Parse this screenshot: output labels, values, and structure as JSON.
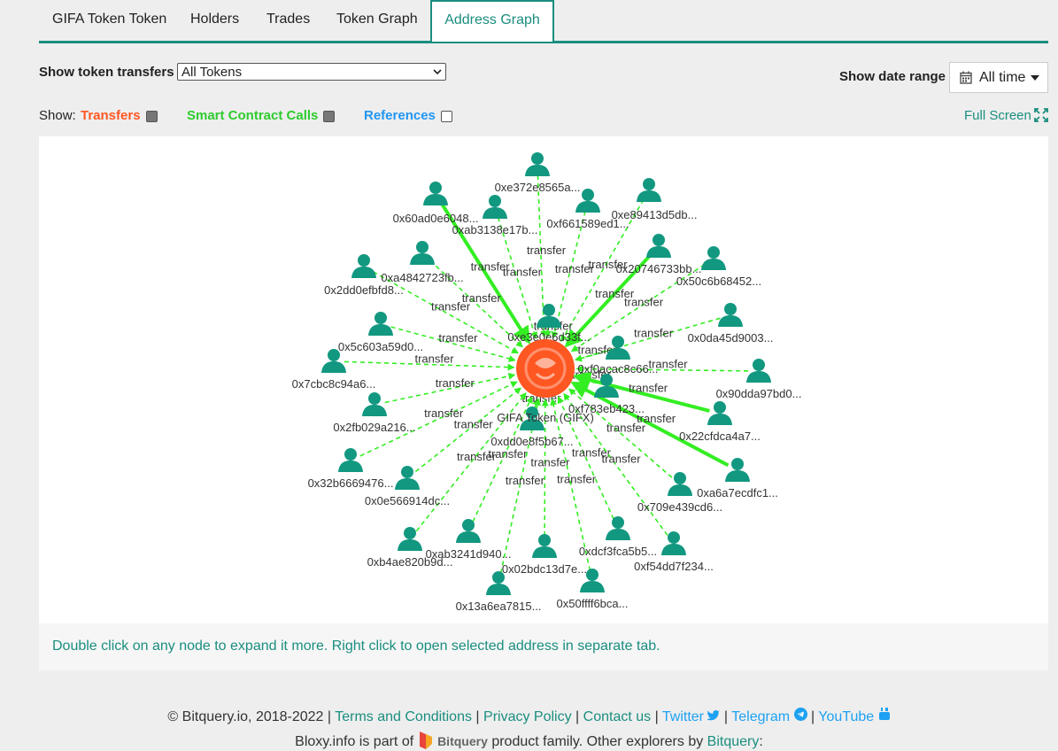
{
  "tabs": [
    "GIFA Token Token",
    "Holders",
    "Trades",
    "Token Graph",
    "Address Graph"
  ],
  "filters": {
    "token_label": "Show token transfers",
    "token_value": "All Tokens",
    "date_label": "Show date range",
    "date_value": "All time"
  },
  "show": {
    "label": "Show:",
    "transfers": "Transfers",
    "smart_contract_calls": "Smart Contract Calls",
    "references": "References",
    "full_screen": "Full Screen"
  },
  "colors": {
    "accent": "#1a8e7f",
    "transfers": "#ff5722",
    "smart_contract_calls": "#2ecc2e",
    "references": "#2196f3",
    "edge": "#33ee22",
    "node": "#129880"
  },
  "graph": {
    "center_label": "GIFA Token (GIFX)",
    "edge_label": "transfer",
    "nodes": [
      "0xe372e8565a...",
      "0x60ad0e6048...",
      "0xab3138e17b...",
      "0xf661589ed1...",
      "0xe89413d5db...",
      "0xa4842723fb...",
      "0x2dd0efbfd8...",
      "0x20746733bb...",
      "0x50c6b68452...",
      "0xe3e0e6d33f...",
      "0x0da45d9003...",
      "0x5c603a59d0...",
      "0x7cbc8c94a6...",
      "0xf0acac8c66...",
      "0x90dda97bd0...",
      "0x2fb029a216...",
      "0xf783eb423...",
      "0x22cfdca4a7...",
      "0xdd0e8f5b67...",
      "0x32b6669476...",
      "0x0e566914dc...",
      "0xa6a7ecdfc1...",
      "0x709e439cd6...",
      "0xb4ae820b9d...",
      "0xab3241d940...",
      "0xdcf3fca5b5...",
      "0xf54dd7f234...",
      "0x02bdc13d7e...",
      "0x13a6ea7815...",
      "0x50ffff6bca..."
    ]
  },
  "hint": "Double click on any node to expand it more. Right click to open selected address in separate tab.",
  "footer": {
    "copyright": "© Bitquery.io, 2018-2022",
    "links": [
      "Terms and Conditions",
      "Privacy Policy",
      "Contact us",
      "Twitter",
      "Telegram",
      "YouTube"
    ],
    "line2_a": "Bloxy.info is part of",
    "brand": "Bitquery",
    "line2_b": "product family. Other explorers by",
    "line2_link": "Bitquery",
    "line2_end": ":"
  }
}
